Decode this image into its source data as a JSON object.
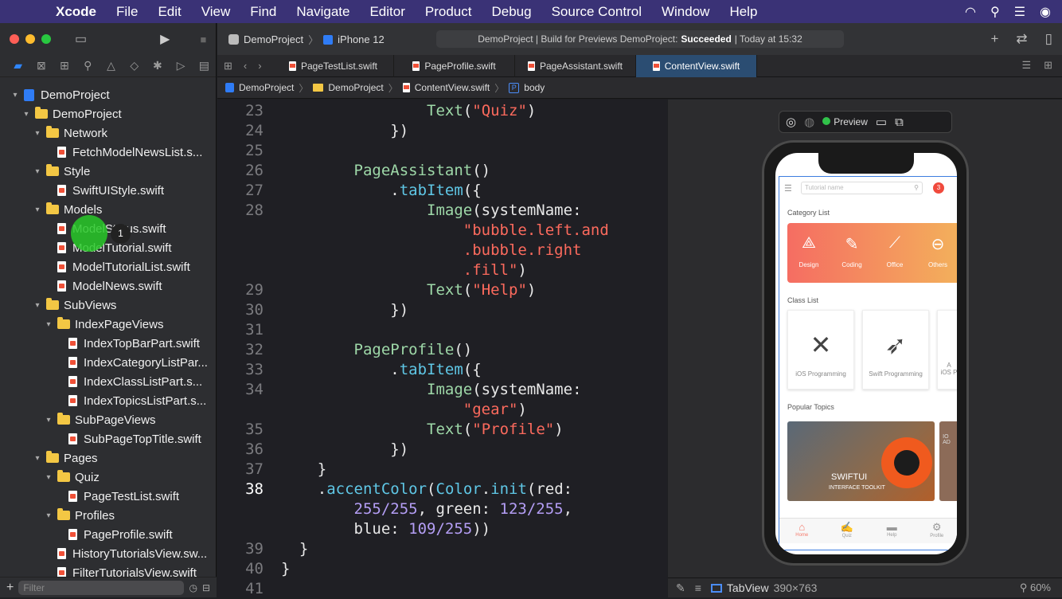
{
  "menubar": {
    "app": "Xcode",
    "items": [
      "File",
      "Edit",
      "View",
      "Find",
      "Navigate",
      "Editor",
      "Product",
      "Debug",
      "Source Control",
      "Window",
      "Help"
    ]
  },
  "toolbar": {
    "project": "DemoProject",
    "device": "iPhone 12",
    "status_prefix": "DemoProject | Build for Previews DemoProject:",
    "status_result": "Succeeded",
    "status_time": "| Today at 15:32"
  },
  "tabs": [
    "PageTestList.swift",
    "PageProfile.swift",
    "PageAssistant.swift",
    "ContentView.swift"
  ],
  "jumpbar": [
    "DemoProject",
    "DemoProject",
    "ContentView.swift",
    "body"
  ],
  "tree": [
    {
      "label": "DemoProject",
      "kind": "project",
      "indent": 0
    },
    {
      "label": "DemoProject",
      "kind": "folder",
      "indent": 1
    },
    {
      "label": "Network",
      "kind": "folder",
      "indent": 2
    },
    {
      "label": "FetchModelNewsList.s...",
      "kind": "file",
      "indent": 3
    },
    {
      "label": "Style",
      "kind": "folder",
      "indent": 2
    },
    {
      "label": "SwiftUIStyle.swift",
      "kind": "file",
      "indent": 3
    },
    {
      "label": "Models",
      "kind": "folder",
      "indent": 2
    },
    {
      "label": "ModelStatus.swift",
      "kind": "file",
      "indent": 3
    },
    {
      "label": "ModelTutorial.swift",
      "kind": "file",
      "indent": 3
    },
    {
      "label": "ModelTutorialList.swift",
      "kind": "file",
      "indent": 3
    },
    {
      "label": "ModelNews.swift",
      "kind": "file",
      "indent": 3
    },
    {
      "label": "SubViews",
      "kind": "folder",
      "indent": 2
    },
    {
      "label": "IndexPageViews",
      "kind": "folder",
      "indent": 3
    },
    {
      "label": "IndexTopBarPart.swift",
      "kind": "file",
      "indent": 4
    },
    {
      "label": "IndexCategoryListPar...",
      "kind": "file",
      "indent": 4
    },
    {
      "label": "IndexClassListPart.s...",
      "kind": "file",
      "indent": 4
    },
    {
      "label": "IndexTopicsListPart.s...",
      "kind": "file",
      "indent": 4
    },
    {
      "label": "SubPageViews",
      "kind": "folder",
      "indent": 3
    },
    {
      "label": "SubPageTopTitle.swift",
      "kind": "file",
      "indent": 4
    },
    {
      "label": "Pages",
      "kind": "folder",
      "indent": 2
    },
    {
      "label": "Quiz",
      "kind": "folder",
      "indent": 3
    },
    {
      "label": "PageTestList.swift",
      "kind": "file",
      "indent": 4
    },
    {
      "label": "Profiles",
      "kind": "folder",
      "indent": 3
    },
    {
      "label": "PageProfile.swift",
      "kind": "file",
      "indent": 4
    },
    {
      "label": "HistoryTutorialsView.sw...",
      "kind": "file",
      "indent": 3
    },
    {
      "label": "FilterTutorialsView.swift",
      "kind": "file",
      "indent": 3
    }
  ],
  "filter_placeholder": "Filter",
  "click_label": "1",
  "code": [
    {
      "n": "23",
      "parts": [
        [
          "",
          "                "
        ],
        [
          "kw-type",
          "Text"
        ],
        [
          "",
          "("
        ],
        [
          "kw-str",
          "\"Quiz\""
        ],
        [
          "",
          ")"
        ]
      ]
    },
    {
      "n": "24",
      "parts": [
        [
          "",
          "            })"
        ]
      ]
    },
    {
      "n": "25",
      "parts": [
        [
          "",
          ""
        ]
      ]
    },
    {
      "n": "26",
      "parts": [
        [
          "",
          "        "
        ],
        [
          "kw-type",
          "PageAssistant"
        ],
        [
          "",
          "()"
        ]
      ]
    },
    {
      "n": "27",
      "parts": [
        [
          "",
          "            ."
        ],
        [
          "kw-fn",
          "tabItem"
        ],
        [
          "",
          "({"
        ]
      ]
    },
    {
      "n": "28",
      "parts": [
        [
          "",
          "                "
        ],
        [
          "kw-type",
          "Image"
        ],
        [
          "",
          "(systemName:"
        ]
      ]
    },
    {
      "n": "",
      "parts": [
        [
          "",
          "                    "
        ],
        [
          "kw-str",
          "\"bubble.left.and"
        ]
      ]
    },
    {
      "n": "",
      "parts": [
        [
          "",
          "                    "
        ],
        [
          "kw-str",
          ".bubble.right"
        ]
      ]
    },
    {
      "n": "",
      "parts": [
        [
          "",
          "                    "
        ],
        [
          "kw-str",
          ".fill\""
        ],
        [
          "",
          ")"
        ]
      ]
    },
    {
      "n": "29",
      "parts": [
        [
          "",
          "                "
        ],
        [
          "kw-type",
          "Text"
        ],
        [
          "",
          "("
        ],
        [
          "kw-str",
          "\"Help\""
        ],
        [
          "",
          ")"
        ]
      ]
    },
    {
      "n": "30",
      "parts": [
        [
          "",
          "            })"
        ]
      ]
    },
    {
      "n": "31",
      "parts": [
        [
          "",
          ""
        ]
      ]
    },
    {
      "n": "32",
      "parts": [
        [
          "",
          "        "
        ],
        [
          "kw-type",
          "PageProfile"
        ],
        [
          "",
          "()"
        ]
      ]
    },
    {
      "n": "33",
      "parts": [
        [
          "",
          "            ."
        ],
        [
          "kw-fn",
          "tabItem"
        ],
        [
          "",
          "({"
        ]
      ]
    },
    {
      "n": "34",
      "parts": [
        [
          "",
          "                "
        ],
        [
          "kw-type",
          "Image"
        ],
        [
          "",
          "(systemName:"
        ]
      ]
    },
    {
      "n": "",
      "parts": [
        [
          "",
          "                    "
        ],
        [
          "kw-str",
          "\"gear\""
        ],
        [
          "",
          ")"
        ]
      ]
    },
    {
      "n": "35",
      "parts": [
        [
          "",
          "                "
        ],
        [
          "kw-type",
          "Text"
        ],
        [
          "",
          "("
        ],
        [
          "kw-str",
          "\"Profile\""
        ],
        [
          "",
          ")"
        ]
      ]
    },
    {
      "n": "36",
      "parts": [
        [
          "",
          "            })"
        ]
      ]
    },
    {
      "n": "37",
      "parts": [
        [
          "",
          "    }"
        ]
      ]
    },
    {
      "n": "38",
      "cur": true,
      "parts": [
        [
          "",
          "    ."
        ],
        [
          "kw-fn",
          "accentColor"
        ],
        [
          "",
          "("
        ],
        [
          "kw-fn",
          "Color"
        ],
        [
          "",
          "."
        ],
        [
          "kw-fn",
          "init"
        ],
        [
          "",
          "(red:"
        ]
      ]
    },
    {
      "n": "",
      "parts": [
        [
          "",
          "        "
        ],
        [
          "kw-num",
          "255/255"
        ],
        [
          "",
          ", green: "
        ],
        [
          "kw-num",
          "123/255"
        ],
        [
          "",
          ","
        ]
      ]
    },
    {
      "n": "",
      "parts": [
        [
          "",
          "        blue: "
        ],
        [
          "kw-num",
          "109/255"
        ],
        [
          "",
          "))"
        ]
      ]
    },
    {
      "n": "39",
      "parts": [
        [
          "",
          "  }"
        ]
      ]
    },
    {
      "n": "40",
      "parts": [
        [
          "",
          "}"
        ]
      ]
    },
    {
      "n": "41",
      "parts": [
        [
          "",
          ""
        ]
      ]
    }
  ],
  "preview": {
    "label": "Preview",
    "search_placeholder": "Tutorial name",
    "badge": "3",
    "category_title": "Category List",
    "categories": [
      "Design",
      "Coding",
      "Office",
      "Others"
    ],
    "class_title": "Class List",
    "classes": [
      "iOS Programming",
      "Swift Programming"
    ],
    "class_partial": "A\niOS P",
    "topics_title": "Popular Topics",
    "topic_title": "SWIFTUI",
    "topic_sub": "INTERFACE TOOLKIT",
    "topic2_text": "IO\nAD",
    "tabbar": [
      "Home",
      "Quiz",
      "Help",
      "Profile"
    ]
  },
  "bottom": {
    "view": "TabView",
    "size": "390×763",
    "zoom": "60%"
  }
}
